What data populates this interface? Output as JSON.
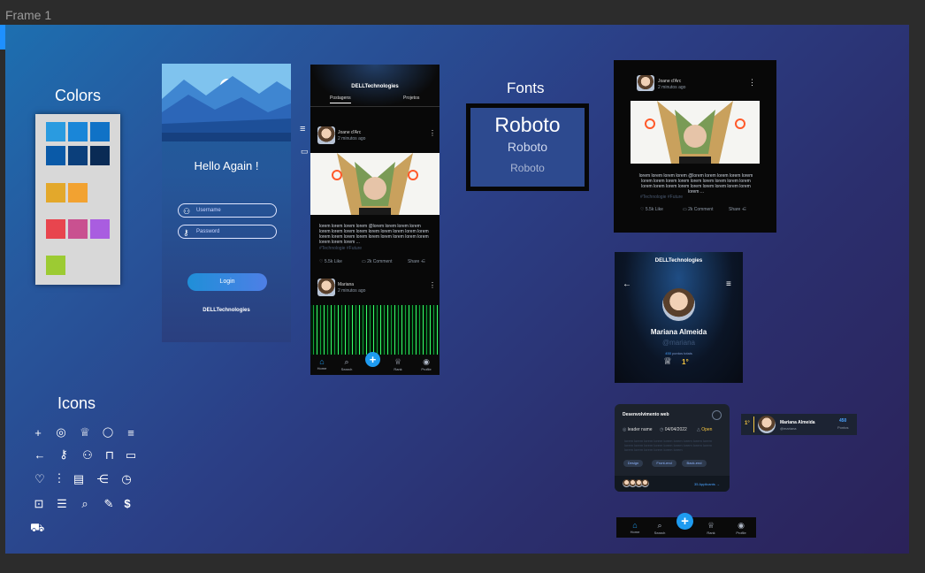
{
  "frame": {
    "name": "Frame 1"
  },
  "colors_section": {
    "title": "Colors",
    "swatches": [
      "#2a9be0",
      "#1a86d8",
      "#1072c6",
      "#0a5aa8",
      "#0b3f7b",
      "#0a2b55",
      "#e3a82b",
      "#f2a231",
      "#e8454e",
      "#c95190",
      "#a95de0",
      "#9ccb33"
    ]
  },
  "login": {
    "greeting": "Hello Again !",
    "username_placeholder": "Username",
    "password_placeholder": "Password",
    "login_button": "Login",
    "brand": "DELLTechnologies"
  },
  "feed": {
    "brand": "DELLTechnologies",
    "tabs": [
      "Postagens",
      "Projetos"
    ],
    "post1": {
      "author": "Joane d'Arc",
      "time": "2 minutos ago",
      "text": "lorem lorem lorem lorem @lorem lorem lorem lorem lorem lorem lorem lorem lorem lorem lorem lorem lorem lorem lorem lorem lorem lorem lorem lorem lorem lorem lorem lorem lorem ...",
      "tags": "#Technologie #Future",
      "likes": "5.5k Like",
      "comments": "2k Comment",
      "share": "Share"
    },
    "post2": {
      "author": "Mariana",
      "time": "2 minutos ago"
    },
    "nav": [
      "Home",
      "Search",
      "Rank",
      "Profile"
    ],
    "fab": "+"
  },
  "fonts_section": {
    "title": "Fonts",
    "samples": [
      "Roboto",
      "Roboto",
      "Roboto"
    ]
  },
  "post_card": {
    "author": "Joane d'Arc",
    "time": "2 minutos ago",
    "text": "lorem lorem lorem lorem @lorem lorem lorem lorem lorem lorem lorem lorem lorem lorem lorem lorem lorem lorem lorem lorem lorem lorem lorem lorem lorem lorem lorem lorem ...",
    "tags": "#Technologie #Future",
    "likes": "5.5k Like",
    "comments": "2k Comment",
    "share": "Share"
  },
  "profile": {
    "brand": "DELLTechnologies",
    "name": "Mariana Almeida",
    "handle": "@mariana",
    "points": "450",
    "points_label": "pontos totais",
    "rank": "1°"
  },
  "project_card": {
    "title": "Desenvolvimento web",
    "leader": "leader name",
    "date": "04/04/2022",
    "status": "Open",
    "description": "lorem lorem lorem lorem lorem lorem lorem lorem lorem lorem lorem lorem lorem lorem lorem lorem lorem lorem lorem lorem lorem lorem lorem lorem",
    "chips": [
      "Design",
      "Front-end",
      "Back-end"
    ],
    "applicants": "35 Applicants →"
  },
  "rank_row": {
    "rank": "1°",
    "name": "Mariana Almeida",
    "handle": "@mariana",
    "points": "450",
    "points_label": "Pontos"
  },
  "bottom_nav": {
    "items": [
      "Home",
      "Search",
      "Rank",
      "Profile"
    ],
    "fab": "+"
  },
  "icons_section": {
    "title": "Icons"
  }
}
